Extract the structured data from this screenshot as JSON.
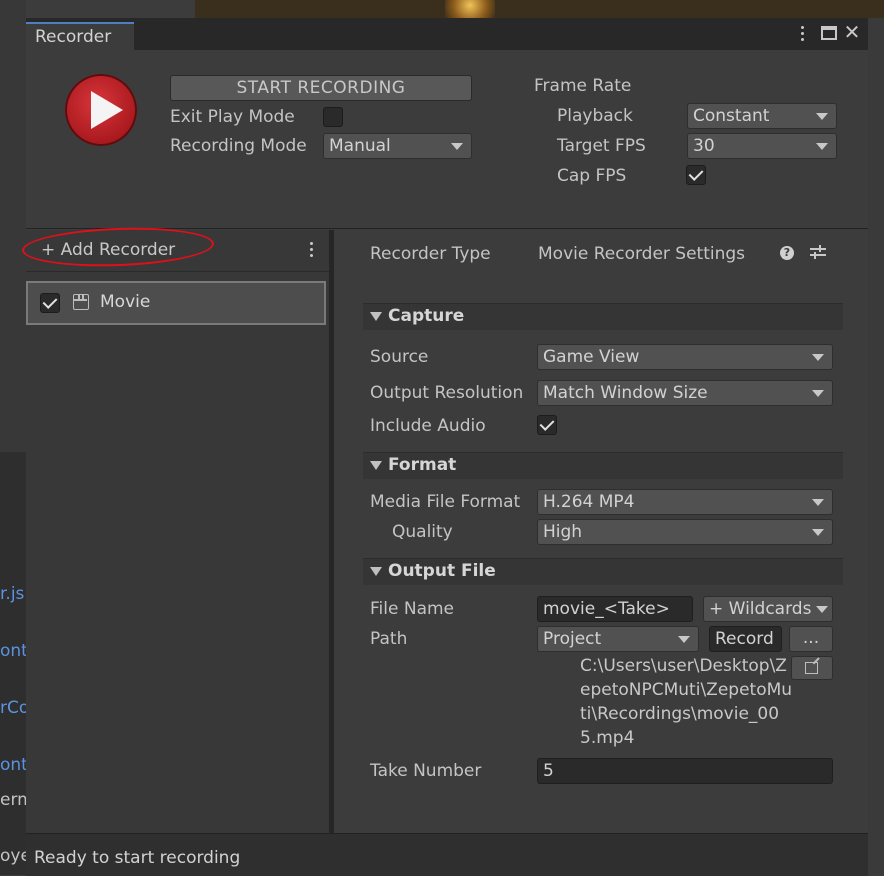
{
  "background": {
    "left_rows": [
      {
        "text": "r.js",
        "kind": "link"
      },
      {
        "text": "ont",
        "kind": "link"
      },
      {
        "text": "rCo",
        "kind": "link"
      },
      {
        "text": "ont",
        "kind": "link"
      },
      {
        "text": "erm",
        "kind": "plain"
      },
      {
        "text": "oye",
        "kind": "plain"
      }
    ]
  },
  "window": {
    "tab_title": "Recorder"
  },
  "header": {
    "start_recording_label": "START RECORDING",
    "exit_play_mode_label": "Exit Play Mode",
    "exit_play_mode_checked": false,
    "recording_mode_label": "Recording Mode",
    "recording_mode_value": "Manual",
    "frame_rate_label": "Frame Rate",
    "playback_label": "Playback",
    "playback_value": "Constant",
    "target_fps_label": "Target FPS",
    "target_fps_value": "30",
    "cap_fps_label": "Cap FPS",
    "cap_fps_checked": true
  },
  "recorder_list": {
    "add_recorder_label": "+ Add Recorder",
    "items": [
      {
        "label": "Movie",
        "enabled": true,
        "selected": true
      }
    ]
  },
  "settings": {
    "recorder_type_label": "Recorder Type",
    "recorder_type_value": "Movie Recorder Settings",
    "capture": {
      "title": "Capture",
      "source_label": "Source",
      "source_value": "Game View",
      "output_resolution_label": "Output Resolution",
      "output_resolution_value": "Match Window Size",
      "include_audio_label": "Include Audio",
      "include_audio_checked": true
    },
    "format": {
      "title": "Format",
      "media_file_format_label": "Media File Format",
      "media_file_format_value": "H.264 MP4",
      "quality_label": "Quality",
      "quality_value": "High"
    },
    "output_file": {
      "title": "Output File",
      "file_name_label": "File Name",
      "file_name_value": "movie_<Take>",
      "wildcards_label": "+ Wildcards",
      "path_label": "Path",
      "path_root_value": "Project",
      "path_folder_value": "Record",
      "browse_label": "...",
      "full_path_text": "C:\\Users\\user\\Desktop\\ZepetoNPCMuti\\ZepetoMuti\\Recordings\\movie_005.mp4",
      "take_number_label": "Take Number",
      "take_number_value": "5"
    }
  },
  "status_bar": {
    "text": "Ready to start recording"
  },
  "colors": {
    "annotation_circle": "#e0101a",
    "record_button": "#c3232a",
    "link_text": "#5b93e0",
    "tab_accent": "#4f7fbf"
  }
}
